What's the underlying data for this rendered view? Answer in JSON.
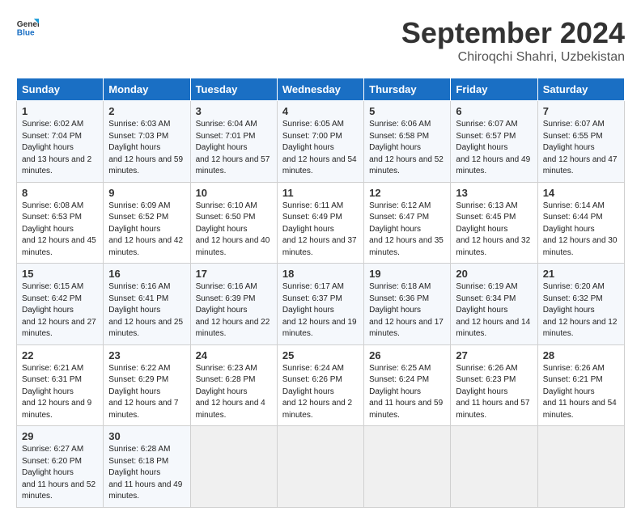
{
  "logo": {
    "line1": "General",
    "line2": "Blue"
  },
  "title": "September 2024",
  "subtitle": "Chiroqchi Shahri, Uzbekistan",
  "header": {
    "days": [
      "Sunday",
      "Monday",
      "Tuesday",
      "Wednesday",
      "Thursday",
      "Friday",
      "Saturday"
    ]
  },
  "weeks": [
    [
      {
        "num": "1",
        "rise": "6:02 AM",
        "set": "7:04 PM",
        "daylight": "13 hours and 2 minutes."
      },
      {
        "num": "2",
        "rise": "6:03 AM",
        "set": "7:03 PM",
        "daylight": "12 hours and 59 minutes."
      },
      {
        "num": "3",
        "rise": "6:04 AM",
        "set": "7:01 PM",
        "daylight": "12 hours and 57 minutes."
      },
      {
        "num": "4",
        "rise": "6:05 AM",
        "set": "7:00 PM",
        "daylight": "12 hours and 54 minutes."
      },
      {
        "num": "5",
        "rise": "6:06 AM",
        "set": "6:58 PM",
        "daylight": "12 hours and 52 minutes."
      },
      {
        "num": "6",
        "rise": "6:07 AM",
        "set": "6:57 PM",
        "daylight": "12 hours and 49 minutes."
      },
      {
        "num": "7",
        "rise": "6:07 AM",
        "set": "6:55 PM",
        "daylight": "12 hours and 47 minutes."
      }
    ],
    [
      {
        "num": "8",
        "rise": "6:08 AM",
        "set": "6:53 PM",
        "daylight": "12 hours and 45 minutes."
      },
      {
        "num": "9",
        "rise": "6:09 AM",
        "set": "6:52 PM",
        "daylight": "12 hours and 42 minutes."
      },
      {
        "num": "10",
        "rise": "6:10 AM",
        "set": "6:50 PM",
        "daylight": "12 hours and 40 minutes."
      },
      {
        "num": "11",
        "rise": "6:11 AM",
        "set": "6:49 PM",
        "daylight": "12 hours and 37 minutes."
      },
      {
        "num": "12",
        "rise": "6:12 AM",
        "set": "6:47 PM",
        "daylight": "12 hours and 35 minutes."
      },
      {
        "num": "13",
        "rise": "6:13 AM",
        "set": "6:45 PM",
        "daylight": "12 hours and 32 minutes."
      },
      {
        "num": "14",
        "rise": "6:14 AM",
        "set": "6:44 PM",
        "daylight": "12 hours and 30 minutes."
      }
    ],
    [
      {
        "num": "15",
        "rise": "6:15 AM",
        "set": "6:42 PM",
        "daylight": "12 hours and 27 minutes."
      },
      {
        "num": "16",
        "rise": "6:16 AM",
        "set": "6:41 PM",
        "daylight": "12 hours and 25 minutes."
      },
      {
        "num": "17",
        "rise": "6:16 AM",
        "set": "6:39 PM",
        "daylight": "12 hours and 22 minutes."
      },
      {
        "num": "18",
        "rise": "6:17 AM",
        "set": "6:37 PM",
        "daylight": "12 hours and 19 minutes."
      },
      {
        "num": "19",
        "rise": "6:18 AM",
        "set": "6:36 PM",
        "daylight": "12 hours and 17 minutes."
      },
      {
        "num": "20",
        "rise": "6:19 AM",
        "set": "6:34 PM",
        "daylight": "12 hours and 14 minutes."
      },
      {
        "num": "21",
        "rise": "6:20 AM",
        "set": "6:32 PM",
        "daylight": "12 hours and 12 minutes."
      }
    ],
    [
      {
        "num": "22",
        "rise": "6:21 AM",
        "set": "6:31 PM",
        "daylight": "12 hours and 9 minutes."
      },
      {
        "num": "23",
        "rise": "6:22 AM",
        "set": "6:29 PM",
        "daylight": "12 hours and 7 minutes."
      },
      {
        "num": "24",
        "rise": "6:23 AM",
        "set": "6:28 PM",
        "daylight": "12 hours and 4 minutes."
      },
      {
        "num": "25",
        "rise": "6:24 AM",
        "set": "6:26 PM",
        "daylight": "12 hours and 2 minutes."
      },
      {
        "num": "26",
        "rise": "6:25 AM",
        "set": "6:24 PM",
        "daylight": "11 hours and 59 minutes."
      },
      {
        "num": "27",
        "rise": "6:26 AM",
        "set": "6:23 PM",
        "daylight": "11 hours and 57 minutes."
      },
      {
        "num": "28",
        "rise": "6:26 AM",
        "set": "6:21 PM",
        "daylight": "11 hours and 54 minutes."
      }
    ],
    [
      {
        "num": "29",
        "rise": "6:27 AM",
        "set": "6:20 PM",
        "daylight": "11 hours and 52 minutes."
      },
      {
        "num": "30",
        "rise": "6:28 AM",
        "set": "6:18 PM",
        "daylight": "11 hours and 49 minutes."
      },
      null,
      null,
      null,
      null,
      null
    ]
  ]
}
